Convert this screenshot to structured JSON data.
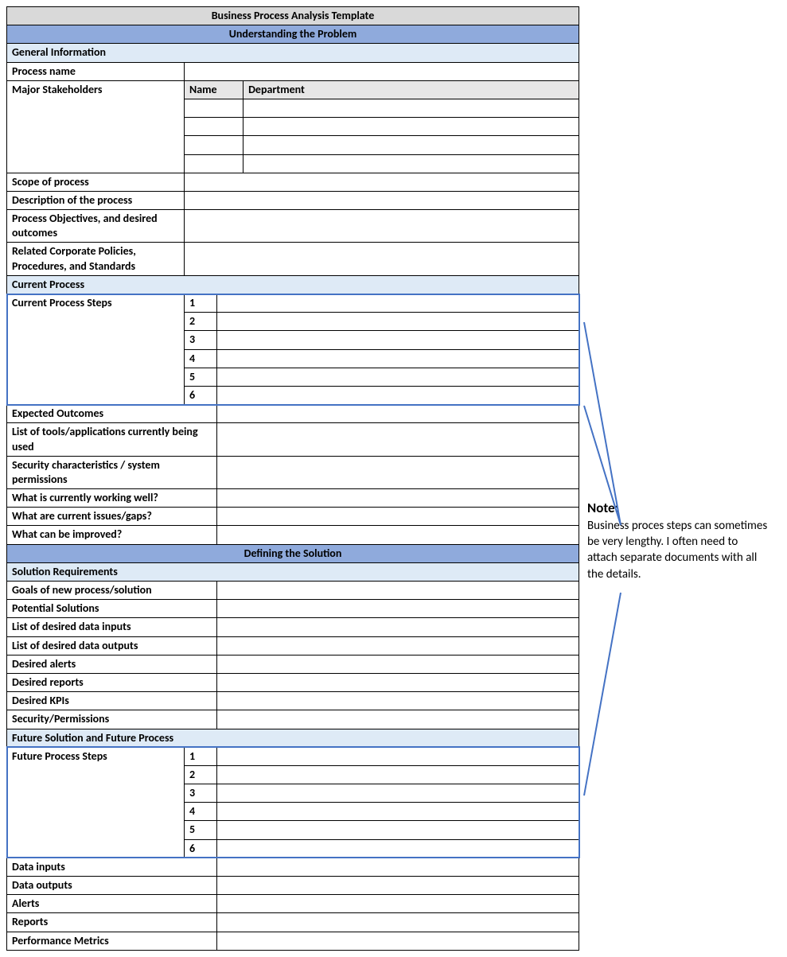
{
  "title": "Business Process Analysis Template",
  "sections": {
    "understanding": "Understanding the Problem",
    "defining": "Defining the Solution"
  },
  "subsections": {
    "general": "General Information",
    "current": "Current Process",
    "solreq": "Solution Requirements",
    "future": "Future Solution and Future Process"
  },
  "labels": {
    "process_name": "Process name",
    "stakeholders": "Major Stakeholders",
    "name": "Name",
    "department": "Department",
    "scope": "Scope of process",
    "description": "Description of the process",
    "objectives": "Process Objectives, and desired outcomes",
    "policies": "Related Corporate Policies, Procedures, and Standards",
    "current_steps": "Current Process Steps",
    "exp_outcomes": "Expected Outcomes",
    "tools": "List of tools/applications currently being used",
    "security": "Security characteristics / system permissions",
    "working_well": "What is currently working well?",
    "issues": "What are current issues/gaps?",
    "improve": "What can be improved?",
    "goals": "Goals of new process/solution",
    "potential": "Potential Solutions",
    "inputs_d": "List of desired data inputs",
    "outputs_d": "List of desired data outputs",
    "alerts_d": "Desired alerts",
    "reports_d": "Desired reports",
    "kpis_d": "Desired KPIs",
    "secperm": "Security/Permissions",
    "future_steps": "Future Process Steps",
    "inputs": "Data inputs",
    "outputs": "Data outputs",
    "alerts": "Alerts",
    "reports": "Reports",
    "perf": "Performance Metrics"
  },
  "steps": [
    "1",
    "2",
    "3",
    "4",
    "5",
    "6"
  ],
  "note": {
    "title": "Note:",
    "body": "Business proces steps can sometimes be very lengthy.  I often need to attach separate documents with all the details."
  }
}
